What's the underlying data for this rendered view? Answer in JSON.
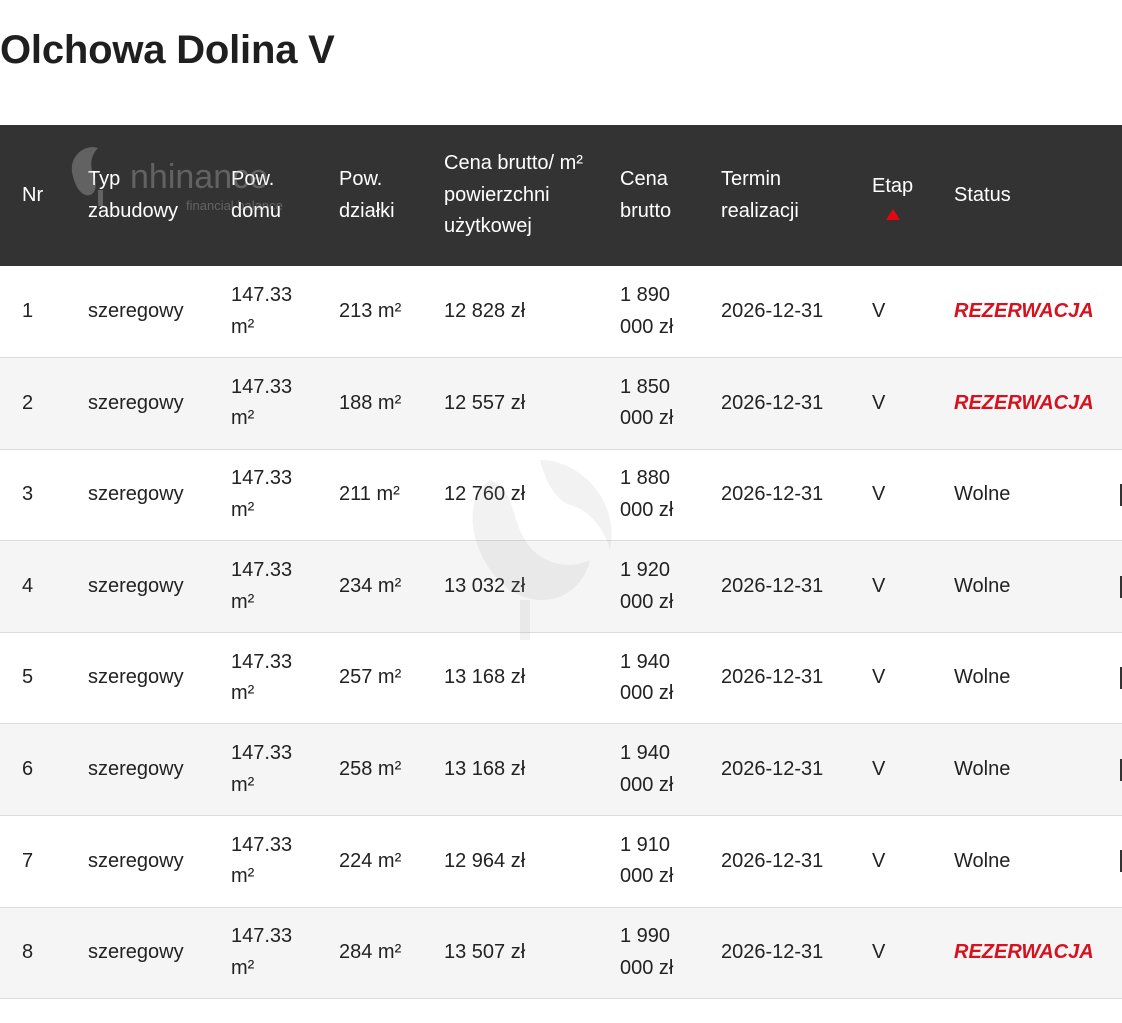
{
  "page": {
    "title": "Olchowa Dolina V"
  },
  "table": {
    "headers": {
      "nr": "Nr",
      "typ": "Typ zabudowy",
      "pow_domu": "Pow. domu",
      "pow_dzialki": "Pow. działki",
      "cena_m2": "Cena brutto/ m² powierzchni użytkowej",
      "cena_brutto": "Cena brutto",
      "termin": "Termin realizacji",
      "etap": "Etap",
      "status": "Status"
    },
    "sort": {
      "column": "Etap",
      "direction": "ascending"
    },
    "rows": [
      {
        "nr": "1",
        "typ": "szeregowy",
        "pow_domu": "147.33 m²",
        "pow_dzialki": "213 m²",
        "cena_m2": "12 828 zł",
        "cena_brutto": "1 890 000 zł",
        "termin": "2026-12-31",
        "etap": "V",
        "status": "REZERWACJA",
        "reserved": true
      },
      {
        "nr": "2",
        "typ": "szeregowy",
        "pow_domu": "147.33 m²",
        "pow_dzialki": "188 m²",
        "cena_m2": "12 557 zł",
        "cena_brutto": "1 850 000 zł",
        "termin": "2026-12-31",
        "etap": "V",
        "status": "REZERWACJA",
        "reserved": true
      },
      {
        "nr": "3",
        "typ": "szeregowy",
        "pow_domu": "147.33 m²",
        "pow_dzialki": "211 m²",
        "cena_m2": "12 760 zł",
        "cena_brutto": "1 880 000 zł",
        "termin": "2026-12-31",
        "etap": "V",
        "status": "Wolne",
        "reserved": false
      },
      {
        "nr": "4",
        "typ": "szeregowy",
        "pow_domu": "147.33 m²",
        "pow_dzialki": "234 m²",
        "cena_m2": "13 032 zł",
        "cena_brutto": "1 920 000 zł",
        "termin": "2026-12-31",
        "etap": "V",
        "status": "Wolne",
        "reserved": false
      },
      {
        "nr": "5",
        "typ": "szeregowy",
        "pow_domu": "147.33 m²",
        "pow_dzialki": "257 m²",
        "cena_m2": "13 168 zł",
        "cena_brutto": "1 940 000 zł",
        "termin": "2026-12-31",
        "etap": "V",
        "status": "Wolne",
        "reserved": false
      },
      {
        "nr": "6",
        "typ": "szeregowy",
        "pow_domu": "147.33 m²",
        "pow_dzialki": "258 m²",
        "cena_m2": "13 168 zł",
        "cena_brutto": "1 940 000 zł",
        "termin": "2026-12-31",
        "etap": "V",
        "status": "Wolne",
        "reserved": false
      },
      {
        "nr": "7",
        "typ": "szeregowy",
        "pow_domu": "147.33 m²",
        "pow_dzialki": "224 m²",
        "cena_m2": "12 964 zł",
        "cena_brutto": "1 910 000 zł",
        "termin": "2026-12-31",
        "etap": "V",
        "status": "Wolne",
        "reserved": false
      },
      {
        "nr": "8",
        "typ": "szeregowy",
        "pow_domu": "147.33 m²",
        "pow_dzialki": "284 m²",
        "cena_m2": "13 507 zł",
        "cena_brutto": "1 990 000 zł",
        "termin": "2026-12-31",
        "etap": "V",
        "status": "REZERWACJA",
        "reserved": true
      }
    ]
  },
  "watermark": {
    "brand": "nhinance",
    "tagline": "financial balance"
  },
  "colors": {
    "header_bg": "#333333",
    "reserved_red": "#d7121f",
    "sort_arrow": "#e30613",
    "row_alt_bg": "#f5f5f5"
  },
  "icons": {
    "sort": "sort-ascending-triangle-icon",
    "watermark": "nhinance-logo-icon"
  }
}
